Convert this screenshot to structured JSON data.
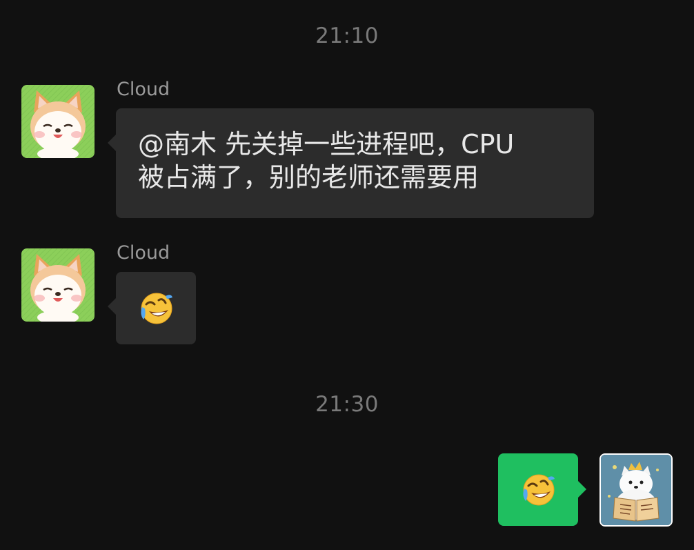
{
  "timestamps": [
    "21:10",
    "21:30"
  ],
  "messages": [
    {
      "sender": "Cloud",
      "text_line1": "@南木 先关掉一些进程吧，CPU",
      "text_line2": "被占满了，别的老师还需要用",
      "avatar_icon": "shiba-dog-avatar"
    },
    {
      "sender": "Cloud",
      "emoji": "face-with-tears-of-joy-lying",
      "avatar_icon": "shiba-dog-avatar"
    },
    {
      "sender": "self",
      "emoji": "face-with-tears-of-joy-lying",
      "avatar_icon": "white-dog-reading-book-avatar"
    }
  ],
  "colors": {
    "background": "#111111",
    "incoming_bubble": "#2c2c2c",
    "outgoing_bubble": "#1fbf60",
    "timestamp_text": "#7a7a7a",
    "sender_text": "#9a9a9a"
  }
}
